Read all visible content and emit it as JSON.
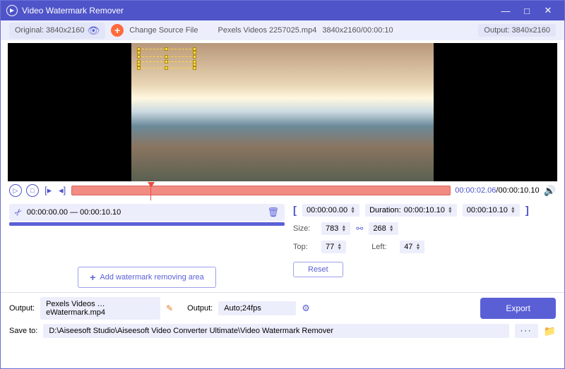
{
  "title": "Video Watermark Remover",
  "topbar": {
    "original": "Original: 3840x2160",
    "change": "Change Source File",
    "filename": "Pexels Videos 2257025.mp4",
    "fileinfo": "3840x2160/00:00:10",
    "output": "Output: 3840x2160"
  },
  "time": {
    "current": "00:00:02.06",
    "total": "/00:00:10.10"
  },
  "clip": {
    "range": "00:00:00.00 — 00:00:10.10"
  },
  "region": {
    "start": "00:00:00.00",
    "end": "00:00:10.10",
    "durLabel": "Duration:",
    "dur": "00:00:10.10",
    "sizeLabel": "Size:",
    "w": "783",
    "h": "268",
    "topLabel": "Top:",
    "top": "77",
    "leftLabel": "Left:",
    "left": "47",
    "reset": "Reset"
  },
  "add": "Add watermark removing area",
  "out": {
    "label1": "Output:",
    "file": "Pexels Videos …eWatermark.mp4",
    "label2": "Output:",
    "fmt": "Auto;24fps",
    "saveLabel": "Save to:",
    "path": "D:\\Aiseesoft Studio\\Aiseesoft Video Converter Ultimate\\Video Watermark Remover",
    "export": "Export"
  }
}
